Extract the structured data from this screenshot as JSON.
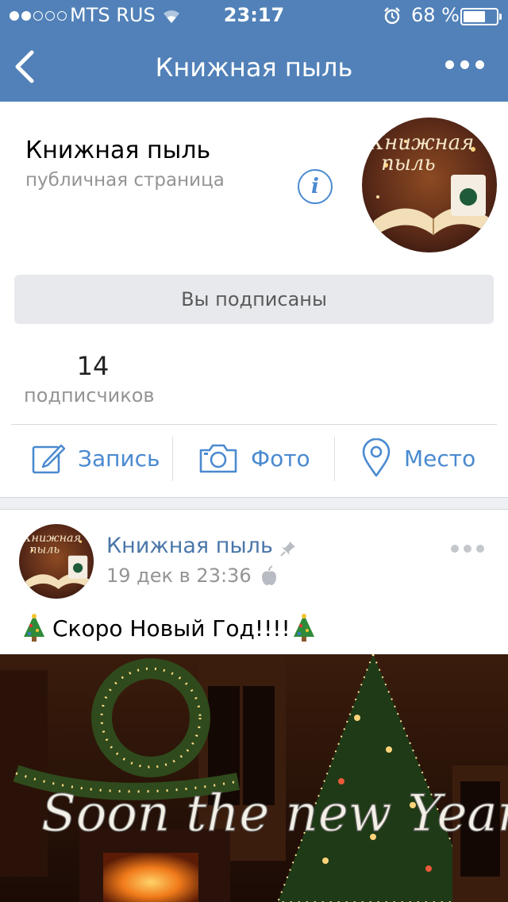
{
  "status_bar": {
    "carrier": "MTS RUS",
    "time": "23:17",
    "battery_percent": "68 %",
    "battery_level": 0.68,
    "signal_bars": 2
  },
  "nav": {
    "title": "Книжная пыль"
  },
  "group": {
    "name": "Книжная пыль",
    "type": "публичная страница",
    "info_icon": "i",
    "avatar_text": [
      "Книжная",
      "пыль"
    ],
    "subscribe_button": "Вы подписаны",
    "followers_count": "14",
    "followers_label": "подписчиков"
  },
  "actions": [
    {
      "label": "Запись",
      "icon": "compose-icon"
    },
    {
      "label": "Фото",
      "icon": "camera-icon"
    },
    {
      "label": "Место",
      "icon": "location-pin-icon"
    }
  ],
  "post": {
    "author": "Книжная пыль",
    "date": "19 дек в 23:36",
    "text": "Скоро Новый Год!!!!",
    "image_caption": "Soon the new Year"
  },
  "colors": {
    "header_bg": "#5181b8",
    "link": "#4a8ad0",
    "author": "#4a76a8"
  }
}
